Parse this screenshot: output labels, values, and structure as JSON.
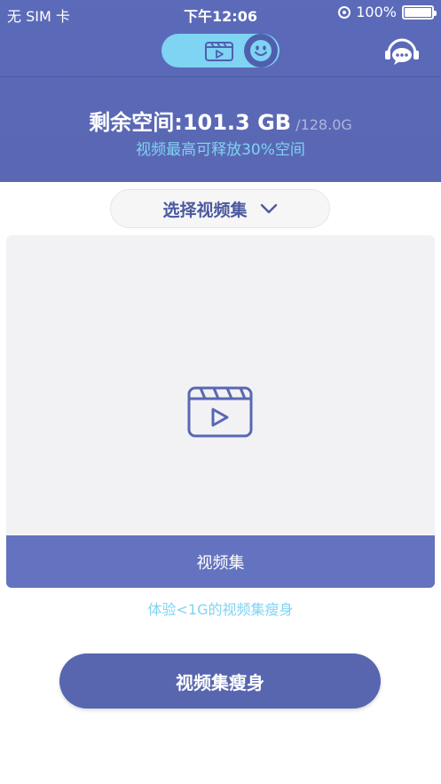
{
  "status_bar": {
    "carrier": "无 SIM 卡",
    "time": "下午12:06",
    "battery": "100%"
  },
  "header": {
    "storage_label": "剩余空间:101.3 GB",
    "storage_total": "/128.0G",
    "storage_hint": "视频最高可释放30%空间"
  },
  "toggle": {
    "left_icon": "video-clapper-icon",
    "right_icon": "smiley-face-icon"
  },
  "support_icon": "headset-chat-icon",
  "select_button": {
    "label": "选择视频集",
    "icon": "chevron-down-icon"
  },
  "card": {
    "icon": "video-clapper-icon",
    "footer_label": "视频集"
  },
  "experience_hint": "体验<1G的视频集瘦身",
  "slim_button": {
    "label": "视频集瘦身"
  },
  "colors": {
    "header_bg": "#5b6ab9",
    "accent_cyan": "#7fd3f3",
    "card_footer": "#6473bf",
    "primary_button": "#5866b0"
  }
}
